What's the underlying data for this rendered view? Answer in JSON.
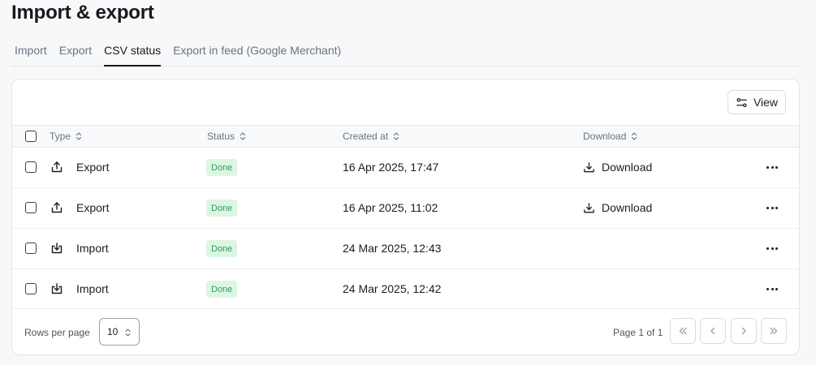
{
  "page": {
    "title": "Import & export"
  },
  "tabs": [
    {
      "label": "Import"
    },
    {
      "label": "Export"
    },
    {
      "label": "CSV status",
      "active": true
    },
    {
      "label": "Export in feed (Google Merchant)"
    }
  ],
  "toolbar": {
    "view_label": "View",
    "view_icon": "sliders-icon"
  },
  "table": {
    "columns": {
      "type": "Type",
      "status": "Status",
      "created": "Created at",
      "download": "Download"
    },
    "rows": [
      {
        "type": "Export",
        "icon": "upload-icon",
        "status": "Done",
        "created": "16 Apr 2025, 17:47",
        "download": "Download"
      },
      {
        "type": "Export",
        "icon": "upload-icon",
        "status": "Done",
        "created": "16 Apr 2025, 11:02",
        "download": "Download"
      },
      {
        "type": "Import",
        "icon": "import-icon",
        "status": "Done",
        "created": "24 Mar 2025, 12:43",
        "download": ""
      },
      {
        "type": "Import",
        "icon": "import-icon",
        "status": "Done",
        "created": "24 Mar 2025, 12:42",
        "download": ""
      }
    ]
  },
  "footer": {
    "rows_per_page_label": "Rows per page",
    "rows_per_page_value": "10",
    "page_info": "Page 1 of 1"
  },
  "colors": {
    "status_done_bg": "#dcf6e3",
    "status_done_text": "#2f9e55"
  }
}
